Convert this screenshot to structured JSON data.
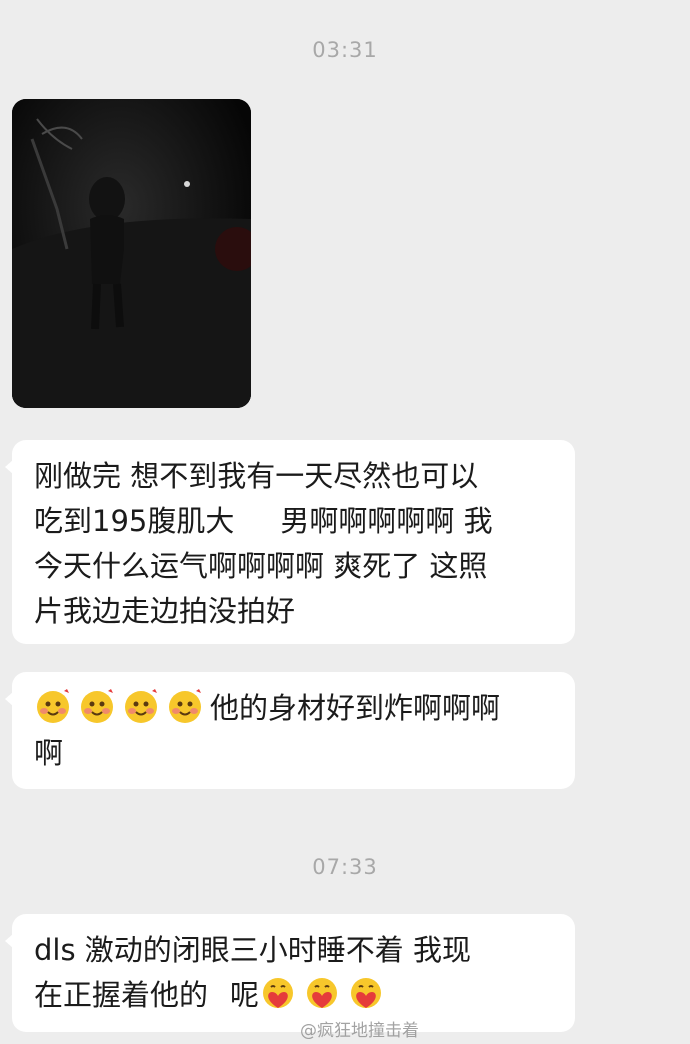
{
  "chat": {
    "timestamp_1": "03:31",
    "message_1": {
      "line_1": "刚做完 想不到我有一天尽然也可以",
      "line_2a": "吃到195腹肌大",
      "line_2b": "男啊啊啊啊啊 我",
      "line_3": "今天什么运气啊啊啊啊 爽死了 这照",
      "line_4": "片我边走边拍没拍好"
    },
    "message_2": {
      "line_1": "他的身材好到炸啊啊啊",
      "line_2": "啊",
      "leading_emoji": [
        "hug-blush-emoji",
        "hug-blush-emoji",
        "hug-blush-emoji",
        "hug-blush-emoji"
      ]
    },
    "timestamp_2": "07:33",
    "message_3": {
      "line_1": "dls 激动的闭眼三小时睡不着 我现",
      "line_2": "在正握着他的",
      "line_2b": "呢",
      "trailing_emoji": [
        "heart-hug-emoji",
        "heart-hug-emoji",
        "heart-hug-emoji"
      ]
    }
  },
  "watermark": "@疯狂地撞击着",
  "colors": {
    "background": "#ededed",
    "bubble": "#ffffff",
    "timestamp": "#a8a8a8",
    "text": "#1b1b1b"
  }
}
